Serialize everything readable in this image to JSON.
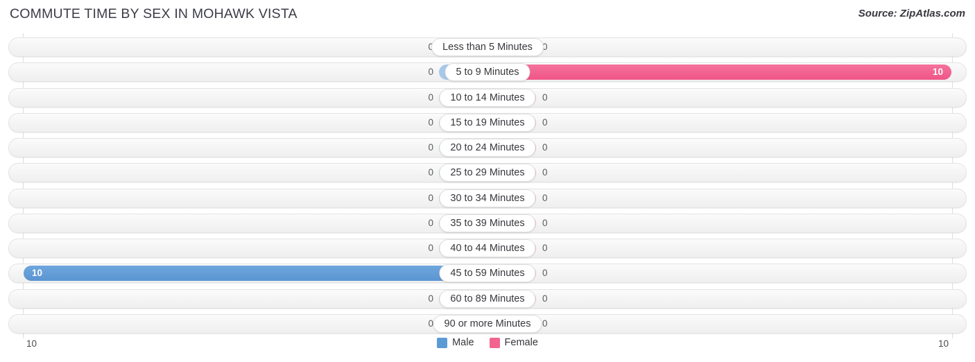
{
  "header": {
    "title": "COMMUTE TIME BY SEX IN MOHAWK VISTA",
    "source": "Source: ZipAtlas.com"
  },
  "axis": {
    "left_label": "10",
    "right_label": "10"
  },
  "legend": {
    "items": [
      {
        "label": "Male",
        "color": "#5b9bd5"
      },
      {
        "label": "Female",
        "color": "#f2648e"
      }
    ]
  },
  "colors": {
    "male": "#5b9bd5",
    "male_zero": "#a8c8ea",
    "female": "#f2648e",
    "female_zero": "#f9a8c4",
    "track": "#f2f2f2",
    "title": "#3c3c46"
  },
  "chart_data": {
    "type": "bar",
    "title": "COMMUTE TIME BY SEX IN MOHAWK VISTA",
    "subtitle": "Source: ZipAtlas.com",
    "orientation": "horizontal",
    "layout": "diverging-centered",
    "xlabel": "",
    "ylabel": "",
    "xlim": [
      10,
      10
    ],
    "grid": true,
    "legend_position": "bottom-center",
    "categories": [
      "Less than 5 Minutes",
      "5 to 9 Minutes",
      "10 to 14 Minutes",
      "15 to 19 Minutes",
      "20 to 24 Minutes",
      "25 to 29 Minutes",
      "30 to 34 Minutes",
      "35 to 39 Minutes",
      "40 to 44 Minutes",
      "45 to 59 Minutes",
      "60 to 89 Minutes",
      "90 or more Minutes"
    ],
    "series": [
      {
        "name": "Male",
        "color": "#5b9bd5",
        "values": [
          0,
          0,
          0,
          0,
          0,
          0,
          0,
          0,
          0,
          10,
          0,
          0
        ],
        "labels": [
          "0",
          "0",
          "0",
          "0",
          "0",
          "0",
          "0",
          "0",
          "0",
          "10",
          "0",
          "0"
        ]
      },
      {
        "name": "Female",
        "color": "#f2648e",
        "values": [
          0,
          10,
          0,
          0,
          0,
          0,
          0,
          0,
          0,
          0,
          0,
          0
        ],
        "labels": [
          "0",
          "10",
          "0",
          "0",
          "0",
          "0",
          "0",
          "0",
          "0",
          "0",
          "0",
          "0"
        ]
      }
    ],
    "axis_max": 10
  }
}
